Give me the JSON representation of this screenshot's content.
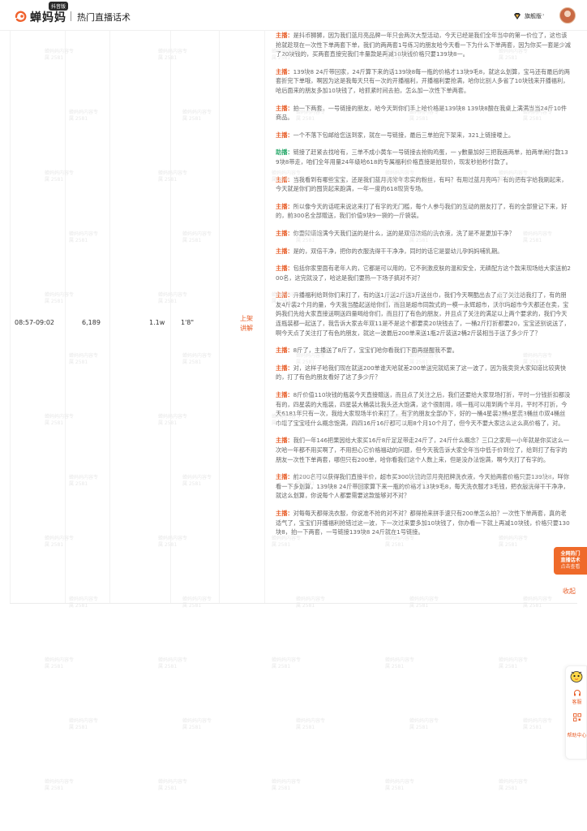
{
  "header": {
    "logo_text": "蝉妈妈",
    "logo_badge": "抖音版",
    "page_title": "热门直播话术",
    "user_level": "旗舰版",
    "user_caret": "›",
    "avatar": "avatar",
    "user_icon": "diamond-badge-icon",
    "logo_icon": "chanmama-logo-icon"
  },
  "row": {
    "time_range": "08:57-09:02",
    "views": "6,189",
    "col_a": "1.1w",
    "col_b": "1'8\"",
    "action_label": "上架讲解"
  },
  "script": [
    {
      "speaker": "主播：",
      "role": "host",
      "text": "是抖币狮狮，因为我们蓝月亮品牌一年只会两次大型活动，今天已经是我们全年当中的第一价位了，这也该抢就趁现在一次性下单两套下单，我们的两两套1号练习的朋友哈今天看一下为什么下单两套，因为你买一套是少减了20块钱的，买两套直接完我们丰量款是再减10块钱价格只要139块8一。"
    },
    {
      "speaker": "主播：",
      "role": "host",
      "text": "139块8 24斤带回家，24斤算下来的话139块8每一瓶的价格才13块9毛8，就这么划算，宝马还有最后的两套折完下单哦，啊因为这是我每天只有一次的开播福利，开播福利要抢满，哈你比别人多省了10块钱来开播福利，哈后面来的朋友多加10块钱了，哈抓紧时间去拍，怎么加一次性下单两套。"
    },
    {
      "speaker": "主播：",
      "role": "host",
      "text": "拍一下两套，一号链接的朋友，哈今天到你们手上哈价格是139块8 139块8酸在我桌上满满当当24斤10件商品。"
    },
    {
      "speaker": "主播：",
      "role": "host",
      "text": "一个不落下包邮给您送到家，就在一号链接，最后三单拍完下架来，321上链接喽上。"
    },
    {
      "speaker": "助播：",
      "role": "helper",
      "text": "链接了赶紧去找哈有，三单不成小黄车一号链接去抢购鸡蛋，一 y數量加好三把我画两单，拍两单闹付款139块8带走，咱们全年用量24年级哈618的专属福利价格直接是拍现价，现发秒拍秒付款了。"
    },
    {
      "speaker": "主播：",
      "role": "host",
      "text": "当我看到有哪些宝宝，还是我们蓝月亮常年忠实的粉丝，有吗？有用过蓝月亮吗？有的把有字给我刷起来，今天就是你们的囤货起来跑满，一年一度的618现货专场。"
    },
    {
      "speaker": "主播：",
      "role": "host",
      "text": "所以像今天的话呢来说这来打了有字的无门槛，每个人参与我们的互动的朋友打了，有的全部登记下来，好的，前300名全部赠送，我们价值9块9一袋的一斤袋装。"
    },
    {
      "speaker": "主播：",
      "role": "host",
      "text": "你要知道饱满今天我们送的是什么，送的是双倍浓缩的洗衣液，洗了是不是更加干净？"
    },
    {
      "speaker": "主播：",
      "role": "host",
      "text": "是的，双倍干净，把你的衣服洗得干干净净，同时的话它是婴幼儿孕妈妈哺乳期。"
    },
    {
      "speaker": "主播：",
      "role": "host",
      "text": "包括你家里面有老年人的，它都是可以用的，它不刺激皮肤的温和安全，无磷配方这个款来现场给大家送前200名，这完就没了，哈这是我们要热一下场子搞对不对？"
    },
    {
      "speaker": "主播：",
      "role": "host",
      "text": "开播福利给到你们来打了，有的送1斤送2斤送3斤送丝巾，我们今天啊酷出去了点了关注给我打了，有的朋友4斤装2个月的量，今天我当酷起送给你们，而且是超市同款式的一模一永辉超市，沃尔玛超市今天都还在卖，宝妈我们先给大家直接送啊送四量喝给你们，而且打了有色的朋友，并且点了关注的满足以上两个要求的，我们今天连瓶装都一起送了，我告诉大家去年双11是不是这个都要卖20块钱去了，一桶2斤打折都要20，宝宝还别说送了，啊今天点了关注打了有色的朋友，就这一波最后200单来送1瓶2斤装送2桶2斤装相当于送了多少斤了？"
    },
    {
      "speaker": "主播：",
      "role": "host",
      "text": "8斤了，主播送了8斤了，宝宝们哈你看我们下面再提醒我不要。"
    },
    {
      "speaker": "主播：",
      "role": "host",
      "text": "对，这样子哈我们现在就送200单谁天哈就差200单送完就结束了这一波了，因为我卖货大家知道比较爽快的，打了有色的朋友看好了这了多少斤？"
    },
    {
      "speaker": "主播：",
      "role": "host",
      "text": "8斤价值110块钱的瓶装今天直接赠送，而且点了关注之后，我们还要给大家现场打折，平时一分钱折扣都没有的，四星装的大瓶装，四星装大桶装比我头还大饱满，这个很耐用，咳一瓶可以用到两个半月，平时不打折，今天6181年只有一次，我给大家现场半价来打了，有字的朋友全部办下，好的一桶4星装2桶4星装3桶丝巾双4桶丝巾增了宝宝哇什么概念饱满，四四16斤16斤都可以用8个月10个月了，但今天不要大家这么这么高价格了，对。"
    },
    {
      "speaker": "主播：",
      "role": "host",
      "text": "我们一年146把果因给大家买16斤8斤足足带走24斤了，24斤什么概念？三口之家用一小年就是你买这么一次哈一年都不用买啊了，不用担心它价格福动的问题，但今天我告诉大家全年当中低于价到位了，给到打了有字的朋友一次性下单两套，哪但只有200单，哈你看我们这个人数上来，但是没办法饱满，啊今天打了有字的。"
    },
    {
      "speaker": "主播：",
      "role": "host",
      "text": "前200名可以获得我们直接半价，超市买300块钱的蓝月亮招牌洗衣液，今天拍两套价格只要139块8，咩你看一下多划算，139块8 24斤带回家算下来一瓶的价格才13块9毛8，每天洗衣服才3毛钱，把衣服洗得干干净净，就这么划算，你说每个人都要需要这款能够对不对？"
    },
    {
      "speaker": "主播：",
      "role": "host",
      "text": "对每每天都得洗衣服，你说准不抢的对不对？都得抢来拼手速只有200单怎么拍？一次性下单两套，真的老适气了，宝宝们开播福利抢错过这一波，下一次过来要多加10块钱了，你办看一下就上再减10块钱，价格只要130块8，拍一下两套，一号链接139块8 24斤就在1号链接。"
    }
  ],
  "collapse_label": "收起",
  "watermark_text": "蝉妈妈内容专属 2581",
  "float_promo": {
    "line1": "全网热门",
    "line2": "直播话术",
    "line3": "点击查看"
  },
  "float_panel": [
    {
      "label": "客服",
      "icon": "headset-icon"
    },
    {
      "label": "",
      "icon": "qrcode-icon"
    },
    {
      "label": "帮助中心",
      "icon": "help-icon"
    }
  ]
}
